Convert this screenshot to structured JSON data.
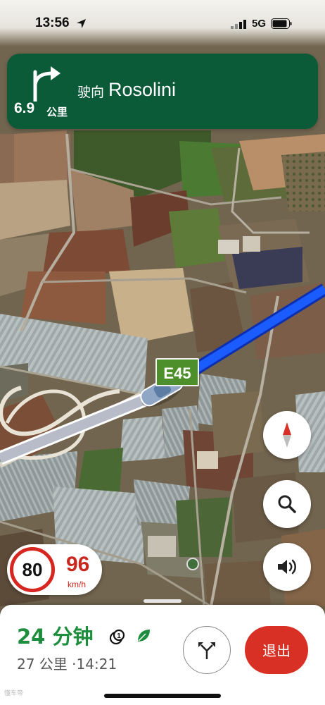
{
  "status_bar": {
    "time": "13:56",
    "network": "5G"
  },
  "turn_banner": {
    "distance_value": "6.9",
    "distance_unit": "公里",
    "instruction_prefix": "驶向",
    "destination_name": "Rosolini",
    "background_color": "#0b5a38"
  },
  "map": {
    "road_shield": "E45",
    "route_color": "#1a5cff"
  },
  "speed": {
    "limit": "80",
    "current": "96",
    "unit": "km/h"
  },
  "map_controls": {
    "compass_icon": "compass-icon",
    "search_icon": "search-icon",
    "sound_icon": "speaker-icon"
  },
  "trip": {
    "duration": "24 分钟",
    "distance": "27 公里",
    "arrival_time": "14:21",
    "separator": "·",
    "exit_label": "退出"
  },
  "watermark": "懂车帝"
}
